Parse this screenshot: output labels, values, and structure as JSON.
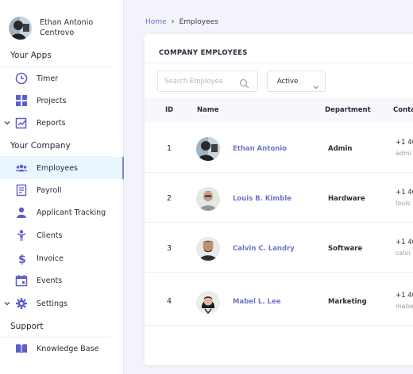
{
  "user": {
    "name_line1": "Ethan Antonio",
    "name_line2": "Centrovo"
  },
  "sidebar": {
    "sections": [
      {
        "title": "Your Apps"
      },
      {
        "title": "Your Company"
      },
      {
        "title": "Support"
      }
    ],
    "items": [
      {
        "label": "Timer",
        "icon": "clock-icon"
      },
      {
        "label": "Projects",
        "icon": "grid-icon"
      },
      {
        "label": "Reports",
        "icon": "report-icon",
        "expandable": true
      },
      {
        "label": "Employees",
        "icon": "people-icon",
        "active": true
      },
      {
        "label": "Payroll",
        "icon": "receipt-icon"
      },
      {
        "label": "Applicant Tracking",
        "icon": "user-icon"
      },
      {
        "label": "Clients",
        "icon": "client-icon"
      },
      {
        "label": "Invoice",
        "icon": "dollar-icon"
      },
      {
        "label": "Events",
        "icon": "calendar-icon"
      },
      {
        "label": "Settings",
        "icon": "gear-icon",
        "expandable": true
      },
      {
        "label": "Knowledge Base",
        "icon": "book-icon"
      }
    ]
  },
  "breadcrumb": {
    "home": "Home",
    "current": "Employees"
  },
  "card": {
    "title": "COMPANY EMPLOYEES",
    "search_placeholder": "Search Employee",
    "status_value": "Active"
  },
  "table": {
    "headers": {
      "id": "ID",
      "name": "Name",
      "department": "Department",
      "contact": "Conta"
    },
    "rows": [
      {
        "id": "1",
        "name": "Ethan Antonio",
        "department": "Admin",
        "contact1": "+1 40",
        "contact2": "admi"
      },
      {
        "id": "2",
        "name": "Louis B. Kimble",
        "department": "Hardware",
        "contact1": "+1 40",
        "contact2": "louis"
      },
      {
        "id": "3",
        "name": "Calvin C. Landry",
        "department": "Software",
        "contact1": "+1 40",
        "contact2": "calvi"
      },
      {
        "id": "4",
        "name": "Mabel L. Lee",
        "department": "Marketing",
        "contact1": "+1 40",
        "contact2": "mabe"
      }
    ]
  },
  "colors": {
    "accent": "#6f75c9",
    "icon": "#5b5fc7",
    "active_bg": "#e9f6fd"
  }
}
